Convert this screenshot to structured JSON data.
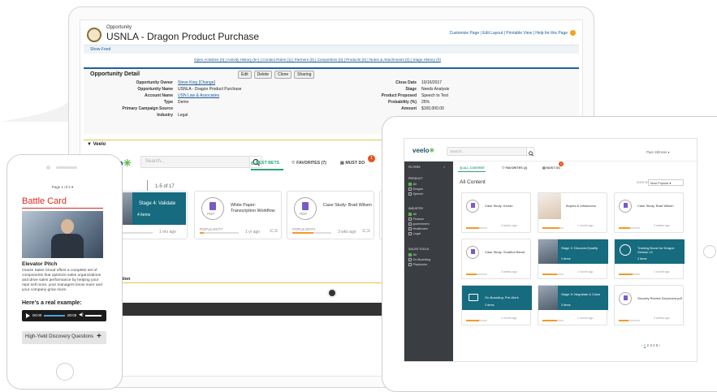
{
  "desktop": {
    "sf": {
      "object_label": "Opportunity",
      "title": "USNLA - Dragon Product Purchase",
      "top_links": "Customize Page | Edit Layout | Printable View | Help for this Page",
      "show_feed": "Show Feed",
      "related_links": "Open Activities (0)  |  Activity History (5+)  |  Contact Roles (1)  |  Partners (0)  |  Competitors (0)  |  Products (0)  |  Notes & Attachments (0)  |  Stage History (0)",
      "detail_title": "Opportunity Detail",
      "buttons": [
        "Edit",
        "Delete",
        "Clone",
        "Sharing"
      ],
      "left_fields": [
        {
          "label": "Opportunity Owner",
          "value": "Steve King [Change]"
        },
        {
          "label": "Opportunity Name",
          "value": "USNLA - Dragon Product Purchase"
        },
        {
          "label": "Account Name",
          "value": "USN Law & Associates"
        },
        {
          "label": "Type",
          "value": "Demo"
        },
        {
          "label": "Primary Campaign Source",
          "value": ""
        },
        {
          "label": "Industry",
          "value": "Legal"
        }
      ],
      "right_fields": [
        {
          "label": "Close Date",
          "value": "10/16/2017"
        },
        {
          "label": "Stage",
          "value": "Needs Analysis"
        },
        {
          "label": "Product Proposed",
          "value": "Speech to Text"
        },
        {
          "label": "Probability (%)",
          "value": "25%"
        },
        {
          "label": "Amount",
          "value": "$100,000.00"
        }
      ]
    },
    "veelo": {
      "section_label": "▼ Veelo",
      "logo": "veelo",
      "search_placeholder": "Search...",
      "tabs": [
        "BEST BETS",
        "FAVORITES (7)",
        "MUST DO"
      ],
      "must_do_badge": "1",
      "heading": "ets",
      "count": "1-5 of 17",
      "teal_card": {
        "title": "Stage 4: Validate",
        "sub": "4 items"
      },
      "teal_pop": "ITY",
      "teal_time": "1 mo ago",
      "cards": [
        {
          "title": "White Paper: Transcription Workflow",
          "pop_label": "POPULARITY",
          "time": "1 yr ago",
          "pop": 0.1
        },
        {
          "title": "Case Study: Brad Wilsen",
          "pop_label": "POPULARITY",
          "time": "3 wks ago",
          "pop": 0.55
        }
      ],
      "pdf_label": "PDF",
      "info_label": "ormation"
    }
  },
  "phone": {
    "page_label": "Page 1 of 4 ▾",
    "title": "Battle Card",
    "subtitle": "Elevator Pitch",
    "paragraph": "Oracle Sales Cloud offers a complete set of components that optimize sales organizations and drive sales performance by helping your reps sell more, your managers know more and your company grow more.",
    "example": "Here's a real example:",
    "audio_start": "00:00",
    "audio_end": "00:05",
    "cta": "High-Yield Discovery Questions",
    "cta_icon": "+"
  },
  "tablet": {
    "logo": "veelo",
    "search_placeholder": "Search...",
    "user": "Paul Johnson ▾",
    "sidebar": {
      "filters_label": "FILTERS",
      "groups": [
        {
          "heading": "PRODUCT",
          "items": [
            "All",
            "Dragon",
            "Speech"
          ]
        },
        {
          "heading": "INDUSTRY",
          "items": [
            "All",
            "Finance",
            "government",
            "Healthcare",
            "Legal"
          ]
        },
        {
          "heading": "SALES TOOLS",
          "items": [
            "All",
            "On-Boarding",
            "Playbooks"
          ]
        }
      ]
    },
    "tabs": [
      "ALL CONTENT",
      "FAVORITES (2)",
      "MUST DO"
    ],
    "must_do_badge": "1",
    "heading": "All Content",
    "sort_label": "SORT BY:",
    "sort_value": "Most Popular  ▾",
    "cards": [
      {
        "title": "Case Study: Kendo",
        "meta": "3 weeks ago",
        "kind": "pdf"
      },
      {
        "title": "Buyers & Influencers",
        "meta": "1 month ago",
        "kind": "photo"
      },
      {
        "title": "Case Study: Brad Wilsen",
        "meta": "3 weeks ago",
        "kind": "pdf"
      },
      {
        "title": "Case Study: Scrafton Blend",
        "meta": "3 weeks ago",
        "kind": "pdf"
      },
      {
        "title": "Stage 2: Discover/Qualify",
        "sub": "3 items",
        "meta": "1 month ago",
        "kind": "teal"
      },
      {
        "title": "Training Boost for Dragon Version 12",
        "sub": "3 items",
        "meta": "1 month ago",
        "kind": "teal"
      },
      {
        "title": "On-Boarding: Pre-Work",
        "sub": "3 items",
        "meta": "1 month ago",
        "kind": "teal"
      },
      {
        "title": "Stage 5: Negotiate & Close",
        "sub": "3 items",
        "meta": "1 month ago",
        "kind": "teal"
      },
      {
        "title": "Security Review Document.pdf",
        "meta": "3 weeks ago",
        "kind": "pdf"
      }
    ],
    "pager": {
      "prev": "‹",
      "pages": [
        "1",
        "2",
        "3",
        "4",
        "5"
      ],
      "next": "›"
    }
  }
}
